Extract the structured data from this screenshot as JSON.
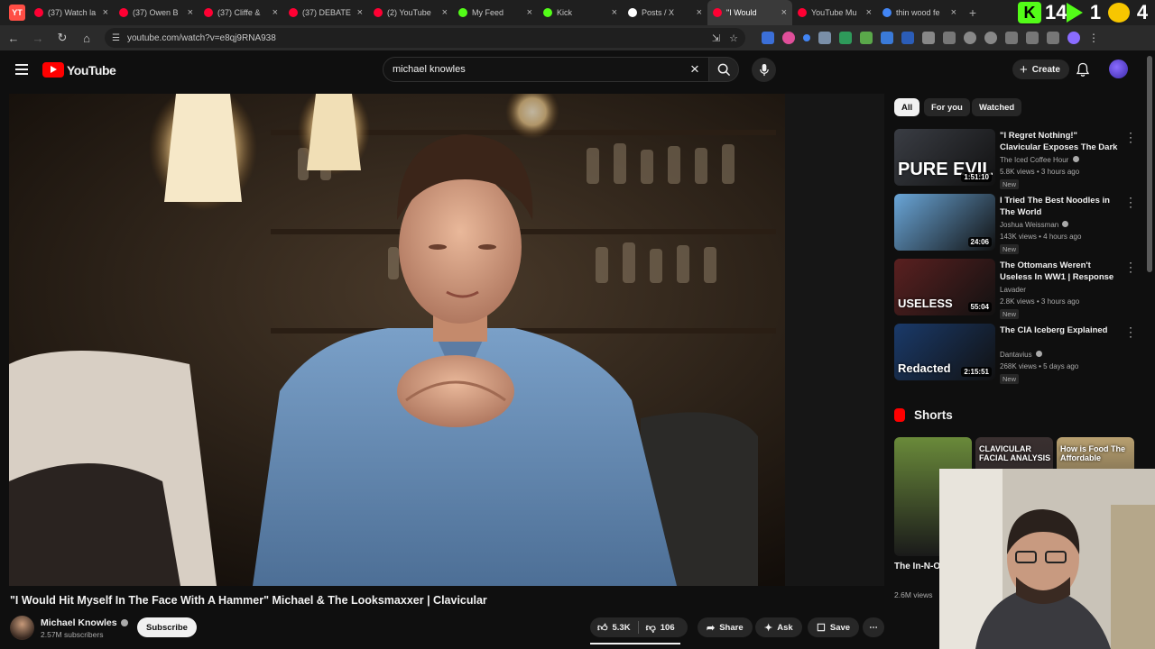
{
  "browser": {
    "tabs": [
      {
        "title": "(37) Watch la",
        "color": "#ff0033"
      },
      {
        "title": "(37) Owen B",
        "color": "#ff0033"
      },
      {
        "title": "(37) Cliffe &",
        "color": "#ff0033"
      },
      {
        "title": "(37) DEBATE",
        "color": "#ff0033"
      },
      {
        "title": "(2) YouTube",
        "color": "#ff0033"
      },
      {
        "title": "My Feed",
        "color": "#53fc18"
      },
      {
        "title": "Kick",
        "color": "#53fc18"
      },
      {
        "title": "Posts / X",
        "color": "#ffffff"
      },
      {
        "title": "\"I Would",
        "color": "#ff0033"
      },
      {
        "title": "YouTube Mu",
        "color": "#ff0033"
      },
      {
        "title": "thin wood fe",
        "color": "#4285f4"
      }
    ],
    "active_tab_index": 8,
    "url": "youtube.com/watch?v=e8qj9RNA938",
    "extension_counters": [
      "14",
      "1",
      "4"
    ]
  },
  "youtube": {
    "logo_text": "YouTube",
    "search_query": "michael knowles",
    "create_label": "Create"
  },
  "video": {
    "title": "\"I Would Hit Myself In The Face With A Hammer\" Michael & The Looksmaxxer | Clavicular",
    "channel": "Michael Knowles",
    "subscribers": "2.57M subscribers",
    "subscribe_label": "Subscribe",
    "likes": "5.3K",
    "dislikes": "106",
    "share_label": "Share",
    "ask_label": "Ask",
    "save_label": "Save"
  },
  "chips": [
    "All",
    "For you",
    "Watched"
  ],
  "recommendations": [
    {
      "title": "\"I Regret Nothing!\" Clavicular Exposes The Dark World Of ...",
      "channel": "The Iced Coffee Hour",
      "verified": true,
      "meta": "5.8K views • 3 hours ago",
      "badge": "New",
      "duration": "1:51:10",
      "thumb_text": "PURE EVIL",
      "thumb_color": "#3a3d44"
    },
    {
      "title": "I Tried The Best Noodles in The World",
      "channel": "Joshua Weissman",
      "verified": true,
      "meta": "143K views • 4 hours ago",
      "badge": "New",
      "duration": "24:06",
      "thumb_text": "",
      "thumb_color": "#6aa6d8"
    },
    {
      "title": "The Ottomans Weren't Useless In WW1 | Response to Henry ...",
      "channel": "Lavader",
      "verified": false,
      "meta": "2.8K views • 3 hours ago",
      "badge": "New",
      "duration": "55:04",
      "thumb_text": "USELESS",
      "thumb_color": "#5a2020"
    },
    {
      "title": "The CIA Iceberg Explained",
      "channel": "Dantavius",
      "verified": true,
      "meta": "268K views • 5 days ago",
      "badge": "New",
      "duration": "2:15:51",
      "thumb_text": "Redacted",
      "thumb_color": "#1a3a6a"
    }
  ],
  "shorts": {
    "heading": "Shorts",
    "items": [
      {
        "title": "The In-N-Out of Tacos is",
        "views": "2.6M views",
        "overlay": "",
        "color": "#6a8a3a"
      },
      {
        "title": "",
        "views": "",
        "overlay": "CLAVICULAR FACIAL ANALYSIS",
        "color": "#3a3030"
      },
      {
        "title": "",
        "views": "",
        "overlay": "How is Food The Affordable",
        "color": "#b8a070"
      }
    ]
  }
}
